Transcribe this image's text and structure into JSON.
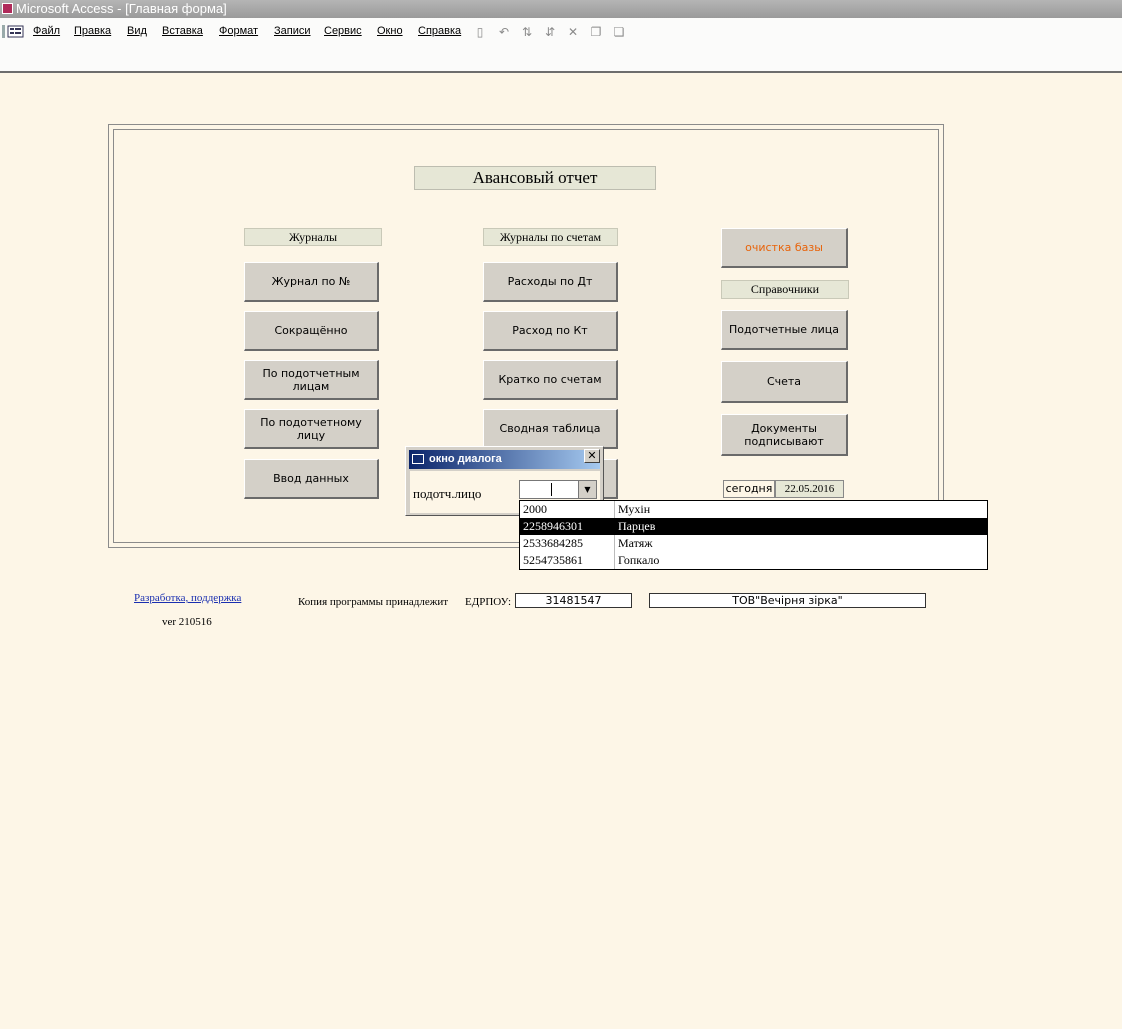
{
  "window": {
    "title": "Microsoft Access - [Главная форма]"
  },
  "menu": [
    "Файл",
    "Правка",
    "Вид",
    "Вставка",
    "Формат",
    "Записи",
    "Сервис",
    "Окно",
    "Справка"
  ],
  "form": {
    "title": "Авансовый отчет",
    "journals": {
      "header": "Журналы",
      "buttons": [
        "Журнал по №",
        "Сокращённо",
        "По подотчетным лицам",
        "По подотчетному лицу",
        "Ввод данных"
      ]
    },
    "account_journals": {
      "header": "Журналы по счетам",
      "buttons": [
        "Расходы по Дт",
        "Расход по Кт",
        "Кратко по счетам",
        "Сводная таблица"
      ]
    },
    "clear_db": "очистка базы",
    "references": {
      "header": "Справочники",
      "buttons": [
        "Подотчетные лица",
        "Счета",
        "Документы подписывают"
      ]
    },
    "today_label": "сегодня",
    "today_value": "22.05.2016"
  },
  "dialog": {
    "title": "окно диалога",
    "label": "подотч.лицо",
    "options": [
      {
        "code": "2000",
        "name": "Мухін"
      },
      {
        "code": "2258946301",
        "name": "Парцев"
      },
      {
        "code": "2533684285",
        "name": "Матяж"
      },
      {
        "code": "5254735861",
        "name": "Гопкало"
      }
    ]
  },
  "footer": {
    "link": "Разработка, поддержка",
    "version": "ver 210516",
    "copy_label": "Копия программы принадлежит",
    "edrpou_label": "ЕДРПОУ:",
    "edrpou_value": "31481547",
    "company": "ТОВ\"Вечірня зірка\""
  },
  "colors": {
    "background": "#fdf6e7",
    "label_bg": "#e6e7d6",
    "button_bg": "#d4d0c8",
    "accent_text": "#e8630a",
    "dialog_title": "#0a246a"
  }
}
